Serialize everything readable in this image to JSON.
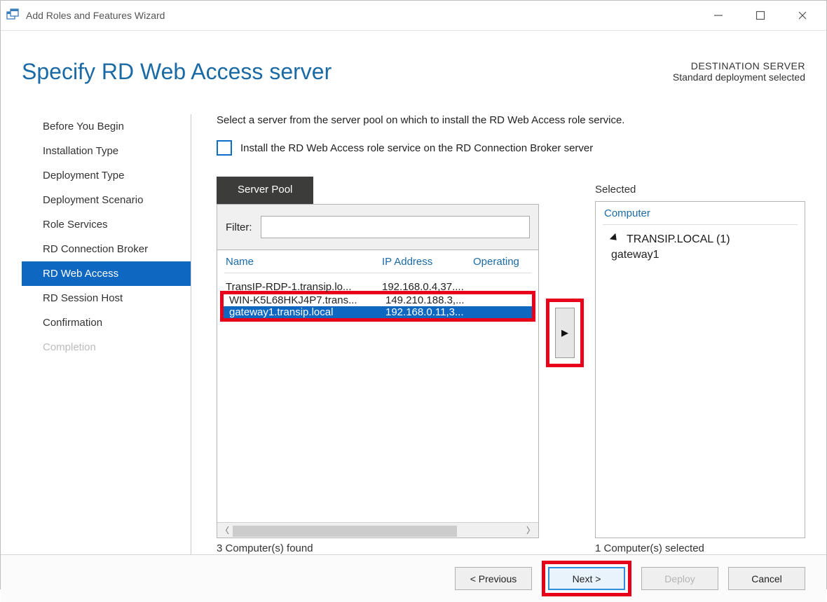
{
  "window": {
    "title": "Add Roles and Features Wizard"
  },
  "header": {
    "title": "Specify RD Web Access server",
    "dest_label": "DESTINATION SERVER",
    "dest_value": "Standard deployment selected"
  },
  "steps": [
    "Before You Begin",
    "Installation Type",
    "Deployment Type",
    "Deployment Scenario",
    "Role Services",
    "RD Connection Broker",
    "RD Web Access",
    "RD Session Host",
    "Confirmation",
    "Completion"
  ],
  "content": {
    "instruction": "Select a server from the server pool on which to install the RD Web Access role service.",
    "checkbox_label": "Install the RD Web Access role service on the RD Connection Broker server",
    "pool_tab": "Server Pool",
    "filter_label": "Filter:",
    "columns": {
      "c1": "Name",
      "c2": "IP Address",
      "c3": "Operating"
    },
    "rows": [
      {
        "name": "TransIP-RDP-1.transip.lo...",
        "ip": "192.168.0.4,37...."
      },
      {
        "name": "WIN-K5L68HKJ4P7.trans...",
        "ip": "149.210.188.3,..."
      },
      {
        "name": "gateway1.transip.local",
        "ip": "192.168.0.11,3..."
      }
    ],
    "found_status": "3 Computer(s) found",
    "selected_title": "Selected",
    "selected_header": "Computer",
    "tree_group": "TRANSIP.LOCAL (1)",
    "tree_item": "gateway1",
    "selected_status": "1 Computer(s) selected",
    "move_glyph": "▶"
  },
  "footer": {
    "prev": "< Previous",
    "next": "Next >",
    "deploy": "Deploy",
    "cancel": "Cancel"
  }
}
